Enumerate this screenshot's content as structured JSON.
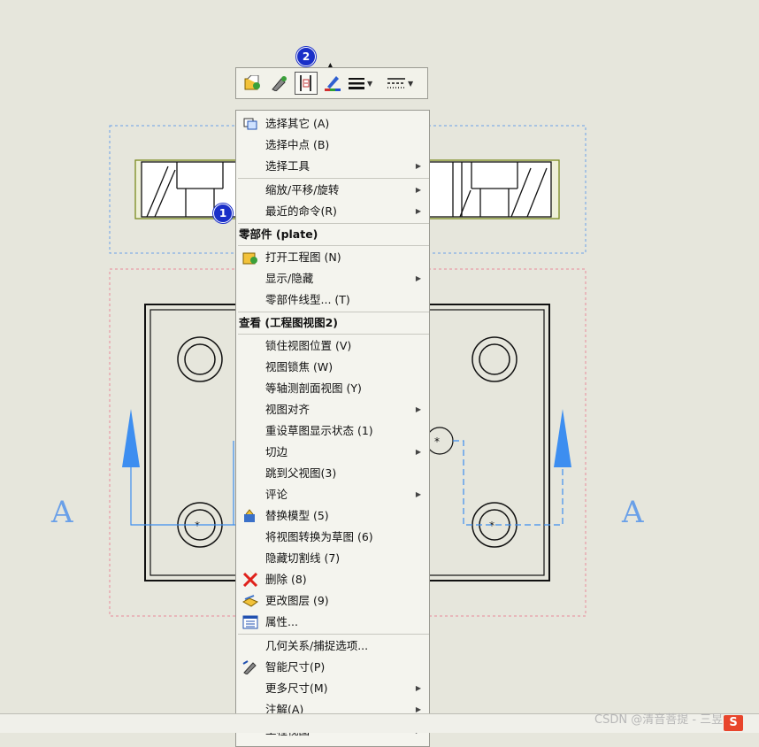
{
  "badges": {
    "one": "1",
    "two": "2"
  },
  "sheet": {
    "section_label_left": "A",
    "section_label_right": "A"
  },
  "toolbar": {
    "icons": [
      "open-drawing-icon",
      "smart-dimension-icon",
      "view-align-icon",
      "color-brush-icon",
      "line-thickness-icon",
      "line-style-icon"
    ],
    "active_index": 2
  },
  "menu": {
    "section1": [
      {
        "label": "选择其它 (A)",
        "icon": "select-other-icon",
        "submenu": false
      },
      {
        "label": "选择中点 (B)",
        "icon": null,
        "submenu": false
      },
      {
        "label": "选择工具",
        "icon": null,
        "submenu": true
      },
      {
        "label": "缩放/平移/旋转",
        "icon": null,
        "submenu": true
      },
      {
        "label": "最近的命令(R)",
        "icon": null,
        "submenu": true
      }
    ],
    "header_part": "零部件 (plate)",
    "section2": [
      {
        "label": "打开工程图 (N)",
        "icon": "open-drawing-icon",
        "submenu": false
      },
      {
        "label": "显示/隐藏",
        "icon": null,
        "submenu": true
      },
      {
        "label": "零部件线型... (T)",
        "icon": null,
        "submenu": false
      }
    ],
    "header_view": "查看 (工程图视图2)",
    "section3": [
      {
        "label": "锁住视图位置 (V)",
        "icon": null,
        "submenu": false
      },
      {
        "label": "视图锁焦 (W)",
        "icon": null,
        "submenu": false
      },
      {
        "label": "等轴测剖面视图 (Y)",
        "icon": null,
        "submenu": false
      },
      {
        "label": "视图对齐",
        "icon": null,
        "submenu": true
      },
      {
        "label": "重设草图显示状态 (1)",
        "icon": null,
        "submenu": false
      },
      {
        "label": "切边",
        "icon": null,
        "submenu": true
      },
      {
        "label": "跳到父视图(3)",
        "icon": null,
        "submenu": false
      },
      {
        "label": "评论",
        "icon": null,
        "submenu": true
      },
      {
        "label": "替换模型 (5)",
        "icon": "replace-model-icon",
        "submenu": false
      },
      {
        "label": "将视图转换为草图 (6)",
        "icon": null,
        "submenu": false
      },
      {
        "label": "隐藏切割线 (7)",
        "icon": null,
        "submenu": false
      },
      {
        "label": "删除 (8)",
        "icon": "delete-icon",
        "submenu": false
      },
      {
        "label": "更改图层 (9)",
        "icon": "change-layer-icon",
        "submenu": false
      },
      {
        "label": "属性...",
        "icon": "properties-icon",
        "submenu": false
      }
    ],
    "section4": [
      {
        "label": "几何关系/捕捉选项...",
        "icon": null,
        "submenu": false
      },
      {
        "label": "智能尺寸(P)",
        "icon": "smart-dimension-icon",
        "submenu": false
      },
      {
        "label": "更多尺寸(M)",
        "icon": null,
        "submenu": true
      },
      {
        "label": "注解(A)",
        "icon": null,
        "submenu": true
      },
      {
        "label": "工程视图",
        "icon": null,
        "submenu": true
      }
    ]
  },
  "watermark": "CSDN @清音菩提 - 三昱",
  "corner_logo": "S",
  "colors": {
    "accent_blue": "#3d8ef0",
    "badge_blue": "#1a2fc8",
    "delete_red": "#e0221c"
  }
}
